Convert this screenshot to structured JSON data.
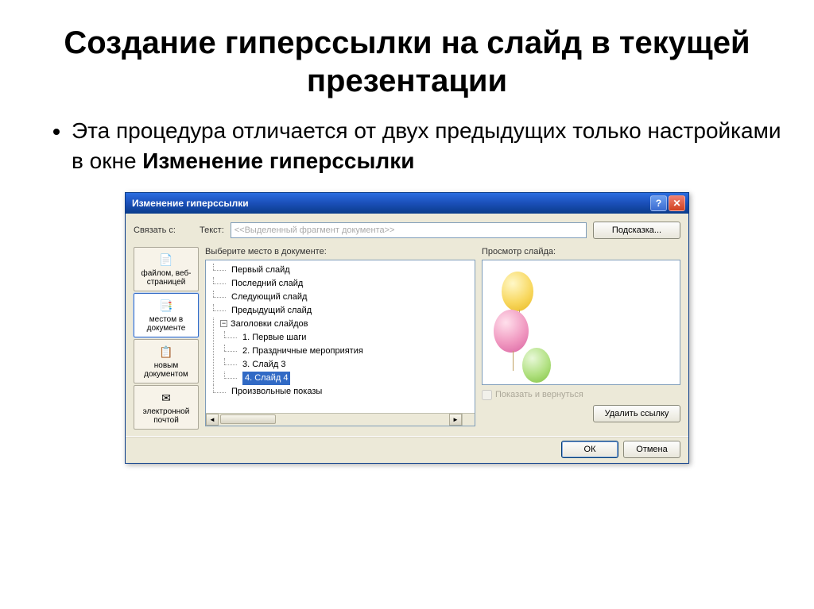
{
  "slide": {
    "title": "Создание гиперссылки на слайд в текущей презентации",
    "bullet": "Эта процедура отличается от двух предыдущих только настройками в окне ",
    "bullet_bold": "Изменение гиперссылки"
  },
  "dialog": {
    "title": "Изменение гиперссылки",
    "link_with": "Связать с:",
    "text_label": "Текст:",
    "text_placeholder": "<<Выделенный фрагмент документа>>",
    "tooltip_btn": "Подсказка...",
    "sidebar": [
      {
        "label": "файлом, веб-страницей",
        "icon": "📄"
      },
      {
        "label": "местом в документе",
        "icon": "📑"
      },
      {
        "label": "новым документом",
        "icon": "📋"
      },
      {
        "label": "электронной почтой",
        "icon": "✉"
      }
    ],
    "select_place": "Выберите место в документе:",
    "tree": {
      "first": "Первый слайд",
      "last": "Последний слайд",
      "next": "Следующий слайд",
      "prev": "Предыдущий слайд",
      "headers": "Заголовки слайдов",
      "s1": "1. Первые шаги",
      "s2": "2. Праздничные мероприятия",
      "s3": "3. Слайд 3",
      "s4": "4. Слайд 4",
      "custom": "Произвольные показы"
    },
    "preview_label": "Просмотр слайда:",
    "show_return": "Показать и вернуться",
    "remove_link": "Удалить ссылку",
    "ok": "ОК",
    "cancel": "Отмена"
  }
}
